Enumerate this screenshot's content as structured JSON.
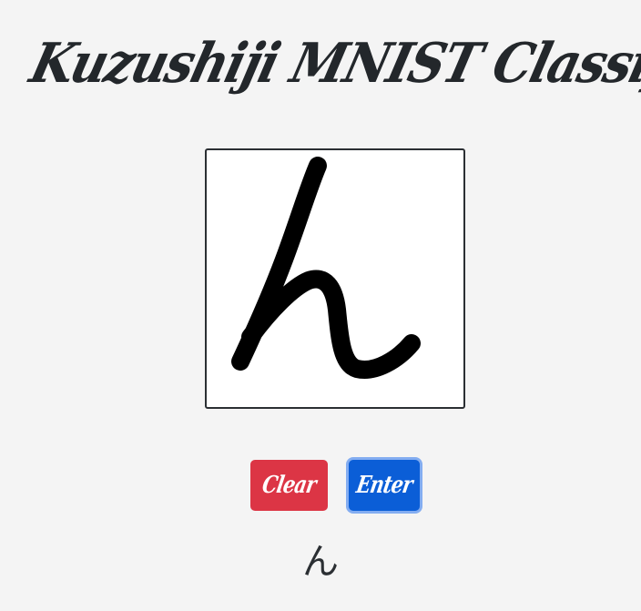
{
  "app": {
    "title": "Kuzushiji MNIST Classifier"
  },
  "canvas": {
    "drawn_character": "ん",
    "stroke_color": "#000000",
    "background_color": "#ffffff"
  },
  "buttons": {
    "clear_label": "Clear",
    "enter_label": "Enter",
    "clear_color": "#dc3545",
    "enter_color": "#0b5ed7"
  },
  "prediction": {
    "result": "ん"
  }
}
